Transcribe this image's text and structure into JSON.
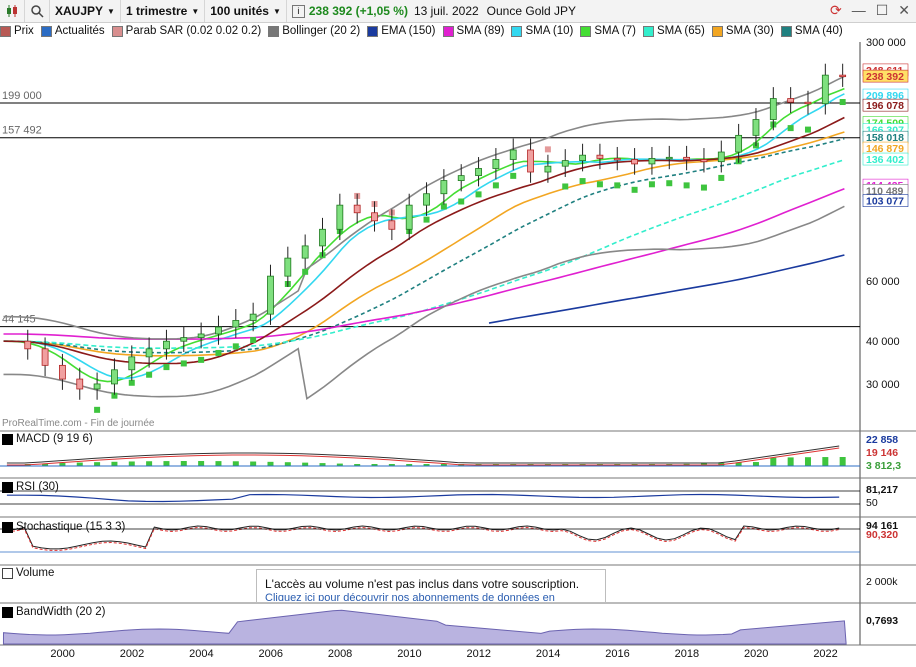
{
  "toolbar": {
    "symbol": "XAUJPY",
    "timeframe": "1 trimestre",
    "units": "100 unités",
    "quote": "238 392 (+1,05 %)",
    "date": "13 juil. 2022",
    "instrument_name": "Ounce Gold JPY"
  },
  "legend": [
    {
      "label": "Prix",
      "color": "#b85a55"
    },
    {
      "label": "Actualités",
      "color": "#2b6cc4"
    },
    {
      "label": "Parab SAR (0.02 0.02 0.2)",
      "color": "#d98f8f"
    },
    {
      "label": "Bollinger (20 2)",
      "color": "#777777"
    },
    {
      "label": "EMA (150)",
      "color": "#1a3a9e"
    },
    {
      "label": "SMA (89)",
      "color": "#e020d0"
    },
    {
      "label": "SMA (10)",
      "color": "#33d8f0"
    },
    {
      "label": "SMA (7)",
      "color": "#44dd33"
    },
    {
      "label": "SMA (65)",
      "color": "#33eecc"
    },
    {
      "label": "SMA (30)",
      "color": "#f2a622"
    },
    {
      "label": "SMA (40)",
      "color": "#1f8080"
    }
  ],
  "panels": {
    "macd": "MACD (9 19 6)",
    "rsi": "RSI (30)",
    "stoch": "Stochastique (15 3 3)",
    "volume": "Volume",
    "bandwidth": "BandWidth (20 2)",
    "source": "ProRealTime.com - Fin de journée"
  },
  "notice": {
    "title": "L'accès au volume n'est pas inclus dans votre souscription.",
    "link": "Cliquez ici pour découvrir nos abonnements de données en temps réel"
  },
  "chart_data": {
    "type": "candlestick",
    "x_ticks": [
      "2000",
      "2002",
      "2004",
      "2006",
      "2008",
      "2010",
      "2012",
      "2014",
      "2016",
      "2018",
      "2020",
      "2022"
    ],
    "y_scale": "log",
    "ylim": [
      22000,
      300000
    ],
    "y_ticks": [
      "300 000",
      "60 000",
      "40 000",
      "30 000"
    ],
    "horizontal_levels": [
      {
        "label": "199 000",
        "value": 199000
      },
      {
        "label": "157 492",
        "value": 157492
      },
      {
        "label": "44 145",
        "value": 44145
      }
    ],
    "price_labels": [
      {
        "text": "248 611",
        "value": 248611,
        "color": "#c33"
      },
      {
        "text": "238 392",
        "value": 238392,
        "color": "#c33"
      },
      {
        "text": "209 896",
        "value": 209896,
        "color": "#33d8f0"
      },
      {
        "text": "196 078",
        "value": 196078,
        "color": "#8b1a1a"
      },
      {
        "text": "174 509",
        "value": 174509,
        "color": "#44dd33"
      },
      {
        "text": "166 307",
        "value": 166307,
        "color": "#33eecc"
      },
      {
        "text": "158 018",
        "value": 158018,
        "color": "#1f8080"
      },
      {
        "text": "146 879",
        "value": 146879,
        "color": "#f2a622"
      },
      {
        "text": "136 402",
        "value": 136402,
        "color": "#33eecc"
      },
      {
        "text": "114 435",
        "value": 114435,
        "color": "#e020d0"
      },
      {
        "text": "110 489",
        "value": 110489,
        "color": "#777777"
      },
      {
        "text": "103 077",
        "value": 103077,
        "color": "#1a3a9e"
      }
    ],
    "close": [
      {
        "t": 1998.5,
        "v": 40000
      },
      {
        "t": 1999.0,
        "v": 38000
      },
      {
        "t": 1999.5,
        "v": 34000
      },
      {
        "t": 2000.0,
        "v": 31000
      },
      {
        "t": 2000.5,
        "v": 29000
      },
      {
        "t": 2001.0,
        "v": 30000
      },
      {
        "t": 2001.5,
        "v": 33000
      },
      {
        "t": 2002.0,
        "v": 36000
      },
      {
        "t": 2002.5,
        "v": 38000
      },
      {
        "t": 2003.0,
        "v": 40000
      },
      {
        "t": 2003.5,
        "v": 41000
      },
      {
        "t": 2004.0,
        "v": 42000
      },
      {
        "t": 2004.5,
        "v": 44000
      },
      {
        "t": 2005.0,
        "v": 46000
      },
      {
        "t": 2005.5,
        "v": 48000
      },
      {
        "t": 2006.0,
        "v": 62000
      },
      {
        "t": 2006.5,
        "v": 70000
      },
      {
        "t": 2007.0,
        "v": 76000
      },
      {
        "t": 2007.5,
        "v": 85000
      },
      {
        "t": 2008.0,
        "v": 100000
      },
      {
        "t": 2008.5,
        "v": 95000
      },
      {
        "t": 2009.0,
        "v": 90000
      },
      {
        "t": 2009.5,
        "v": 85000
      },
      {
        "t": 2010.0,
        "v": 100000
      },
      {
        "t": 2010.5,
        "v": 108000
      },
      {
        "t": 2011.0,
        "v": 118000
      },
      {
        "t": 2011.5,
        "v": 122000
      },
      {
        "t": 2012.0,
        "v": 128000
      },
      {
        "t": 2012.5,
        "v": 136000
      },
      {
        "t": 2013.0,
        "v": 145000
      },
      {
        "t": 2013.5,
        "v": 125000
      },
      {
        "t": 2014.0,
        "v": 130000
      },
      {
        "t": 2014.5,
        "v": 135000
      },
      {
        "t": 2015.0,
        "v": 140000
      },
      {
        "t": 2015.5,
        "v": 137000
      },
      {
        "t": 2016.0,
        "v": 136000
      },
      {
        "t": 2016.5,
        "v": 132000
      },
      {
        "t": 2017.0,
        "v": 137000
      },
      {
        "t": 2017.5,
        "v": 138000
      },
      {
        "t": 2018.0,
        "v": 136000
      },
      {
        "t": 2018.5,
        "v": 134000
      },
      {
        "t": 2019.0,
        "v": 143000
      },
      {
        "t": 2019.5,
        "v": 160000
      },
      {
        "t": 2020.0,
        "v": 178000
      },
      {
        "t": 2020.5,
        "v": 205000
      },
      {
        "t": 2021.0,
        "v": 200000
      },
      {
        "t": 2021.5,
        "v": 198000
      },
      {
        "t": 2022.0,
        "v": 240000
      },
      {
        "t": 2022.5,
        "v": 238392
      }
    ],
    "macd": {
      "labels": [
        "22 858",
        "19 146",
        "3 812,3"
      ]
    },
    "rsi": {
      "value_label": "81,217",
      "tick": "50"
    },
    "stochastic": {
      "labels": [
        "94 161",
        "90,320"
      ]
    },
    "volume": {
      "tick": "2 000k"
    },
    "bandwidth": {
      "value_label": "0,7693"
    }
  }
}
